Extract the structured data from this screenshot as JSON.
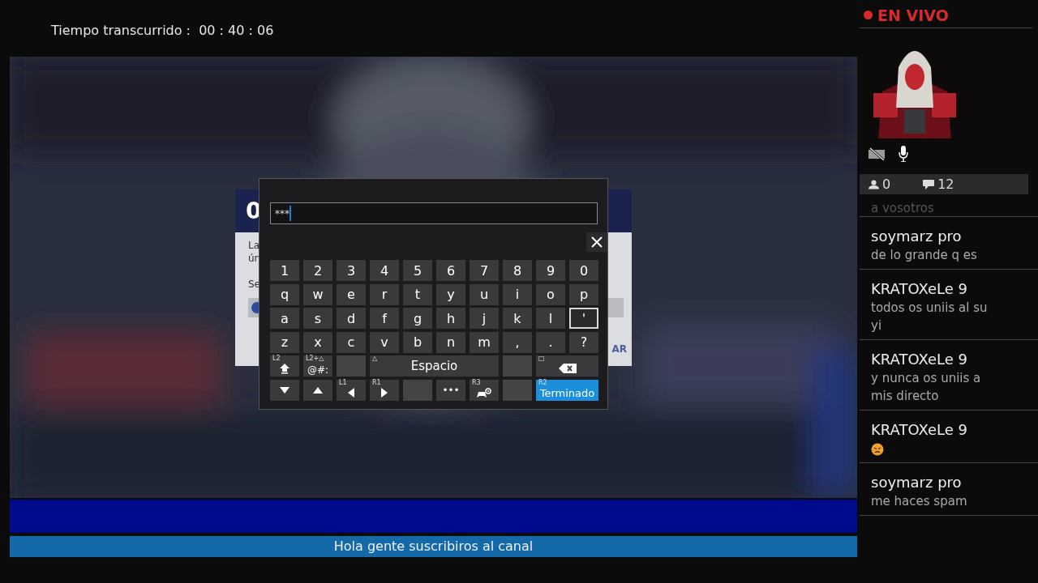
{
  "elapsed": {
    "label": "Tiempo transcurrido :",
    "value": "00 : 40 : 06"
  },
  "dialog_behind": {
    "heading": "0",
    "lines": [
      "La",
      "ún",
      "Se"
    ],
    "action": "AR"
  },
  "keyboard": {
    "input": {
      "value": "***"
    },
    "rows": [
      [
        {
          "kind": "char",
          "label": "1",
          "selected": false
        },
        {
          "kind": "char",
          "label": "2",
          "selected": false
        },
        {
          "kind": "char",
          "label": "3",
          "selected": false
        },
        {
          "kind": "char",
          "label": "4",
          "selected": false
        },
        {
          "kind": "char",
          "label": "5",
          "selected": false
        },
        {
          "kind": "char",
          "label": "6",
          "selected": false
        },
        {
          "kind": "char",
          "label": "7",
          "selected": false
        },
        {
          "kind": "char",
          "label": "8",
          "selected": false
        },
        {
          "kind": "char",
          "label": "9",
          "selected": false
        },
        {
          "kind": "char",
          "label": "0",
          "selected": false
        }
      ],
      [
        {
          "kind": "char",
          "label": "q",
          "selected": false
        },
        {
          "kind": "char",
          "label": "w",
          "selected": false
        },
        {
          "kind": "char",
          "label": "e",
          "selected": false
        },
        {
          "kind": "char",
          "label": "r",
          "selected": false
        },
        {
          "kind": "char",
          "label": "t",
          "selected": false
        },
        {
          "kind": "char",
          "label": "y",
          "selected": false
        },
        {
          "kind": "char",
          "label": "u",
          "selected": false
        },
        {
          "kind": "char",
          "label": "i",
          "selected": false
        },
        {
          "kind": "char",
          "label": "o",
          "selected": false
        },
        {
          "kind": "char",
          "label": "p",
          "selected": false
        }
      ],
      [
        {
          "kind": "char",
          "label": "a",
          "selected": false
        },
        {
          "kind": "char",
          "label": "s",
          "selected": false
        },
        {
          "kind": "char",
          "label": "d",
          "selected": false
        },
        {
          "kind": "char",
          "label": "f",
          "selected": false
        },
        {
          "kind": "char",
          "label": "g",
          "selected": false
        },
        {
          "kind": "char",
          "label": "h",
          "selected": false
        },
        {
          "kind": "char",
          "label": "j",
          "selected": false
        },
        {
          "kind": "char",
          "label": "k",
          "selected": false
        },
        {
          "kind": "char",
          "label": "l",
          "selected": false
        },
        {
          "kind": "char",
          "label": "'",
          "selected": true
        }
      ],
      [
        {
          "kind": "char",
          "label": "z",
          "selected": false
        },
        {
          "kind": "char",
          "label": "x",
          "selected": false
        },
        {
          "kind": "char",
          "label": "c",
          "selected": false
        },
        {
          "kind": "char",
          "label": "v",
          "selected": false
        },
        {
          "kind": "char",
          "label": "b",
          "selected": false
        },
        {
          "kind": "char",
          "label": "n",
          "selected": false
        },
        {
          "kind": "char",
          "label": "m",
          "selected": false
        },
        {
          "kind": "char",
          "label": ",",
          "selected": false
        },
        {
          "kind": "char",
          "label": ".",
          "selected": false
        },
        {
          "kind": "char",
          "label": "?",
          "selected": false
        }
      ],
      [
        {
          "kind": "shift",
          "hint": "L2",
          "selected": false
        },
        {
          "kind": "symbols",
          "label": "@#:",
          "hint": "L2+△",
          "selected": false
        },
        {
          "kind": "blank",
          "selected": false
        },
        {
          "kind": "space",
          "label": "Espacio",
          "hint": "△",
          "selected": false
        },
        {
          "kind": "blank",
          "selected": false
        },
        {
          "kind": "backspace",
          "hint": "□",
          "selected": false
        }
      ],
      [
        {
          "kind": "down",
          "selected": false
        },
        {
          "kind": "up",
          "selected": false
        },
        {
          "kind": "left",
          "hint": "L1",
          "selected": false
        },
        {
          "kind": "right",
          "hint": "R1",
          "selected": false
        },
        {
          "kind": "blank",
          "selected": false
        },
        {
          "kind": "more",
          "label": "•••",
          "selected": false
        },
        {
          "kind": "controller",
          "hint": "R3",
          "selected": false
        },
        {
          "kind": "blank",
          "selected": false
        },
        {
          "kind": "done",
          "label": "Terminado",
          "hint": "R2",
          "selected": false
        }
      ]
    ]
  },
  "banner": {
    "text": "Hola gente suscribiros al canal"
  },
  "live": {
    "label": "EN VIVO"
  },
  "stats": {
    "viewers": "0",
    "comments": "12"
  },
  "chat": [
    {
      "kind": "partial",
      "text": "a vosotros"
    },
    {
      "kind": "message",
      "user": "soymarz pro",
      "text": "de lo grande q es"
    },
    {
      "kind": "message",
      "user": "KRATOXeLe 9",
      "text": "todos os uniis al su yi"
    },
    {
      "kind": "message",
      "user": "KRATOXeLe 9",
      "text": "y nunca os uniis a mis directo"
    },
    {
      "kind": "emoji",
      "user": "KRATOXeLe 9"
    },
    {
      "kind": "message",
      "user": "soymarz pro",
      "text": "me haces spam"
    }
  ]
}
